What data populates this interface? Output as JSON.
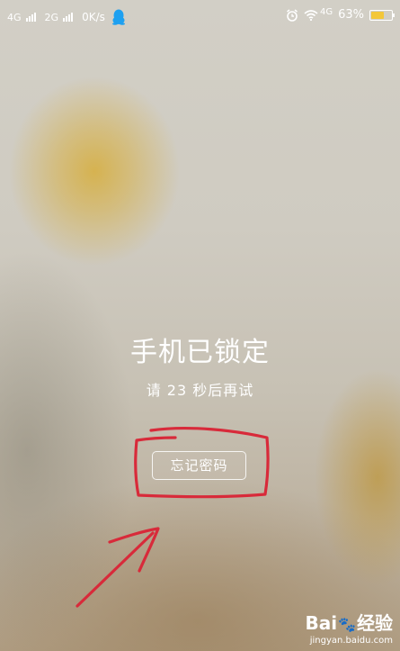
{
  "status_bar": {
    "sim1_network": "4G",
    "sim2_network": "2G",
    "data_speed": "0K/s",
    "notification_icon": "qq-penguin-icon",
    "alarm_icon": "alarm-clock-icon",
    "wifi_icon": "wifi-icon",
    "wifi_network": "4G",
    "battery_percent": "63%",
    "battery_level": 0.63,
    "battery_color": "#f3c73a",
    "qq_color": "#1ea0f0"
  },
  "lock": {
    "title": "手机已锁定",
    "message": "请 23 秒后再试",
    "forgot_button": "忘记密码"
  },
  "annotation": {
    "color": "#d82a3a"
  },
  "watermark": {
    "logo_text_1": "Bai",
    "logo_text_2": "经验",
    "url": "jingyan.baidu.com"
  }
}
